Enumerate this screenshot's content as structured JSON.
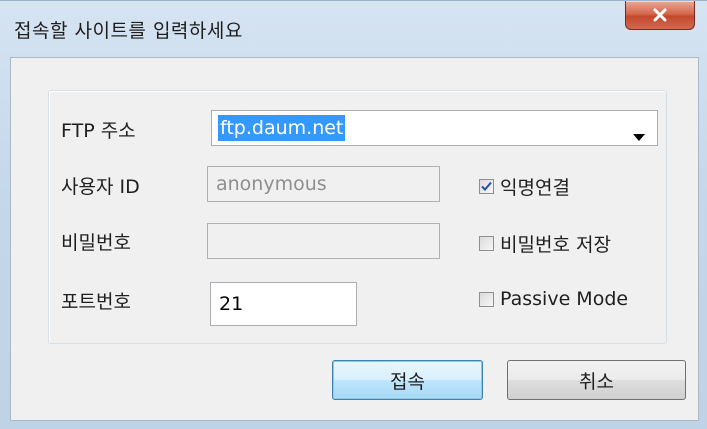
{
  "window": {
    "title": "접속할 사이트를 입력하세요",
    "close_icon": "close-icon"
  },
  "form": {
    "ftp_address_label": "FTP 주소",
    "ftp_address_value": "ftp.daum.net",
    "user_id_label": "사용자 ID",
    "user_id_value": "anonymous",
    "password_label": "비밀번호",
    "password_value": "",
    "port_label": "포트번호",
    "port_value": "21"
  },
  "options": {
    "anonymous": {
      "label": "익명연결",
      "checked": true
    },
    "save_password": {
      "label": "비밀번호 저장",
      "checked": false
    },
    "passive_mode": {
      "label": "Passive Mode",
      "checked": false
    }
  },
  "buttons": {
    "connect_label": "접속",
    "cancel_label": "취소"
  },
  "colors": {
    "selection": "#3399ff",
    "close_button": "#c4482d",
    "default_button_border": "#3c7fb1"
  }
}
